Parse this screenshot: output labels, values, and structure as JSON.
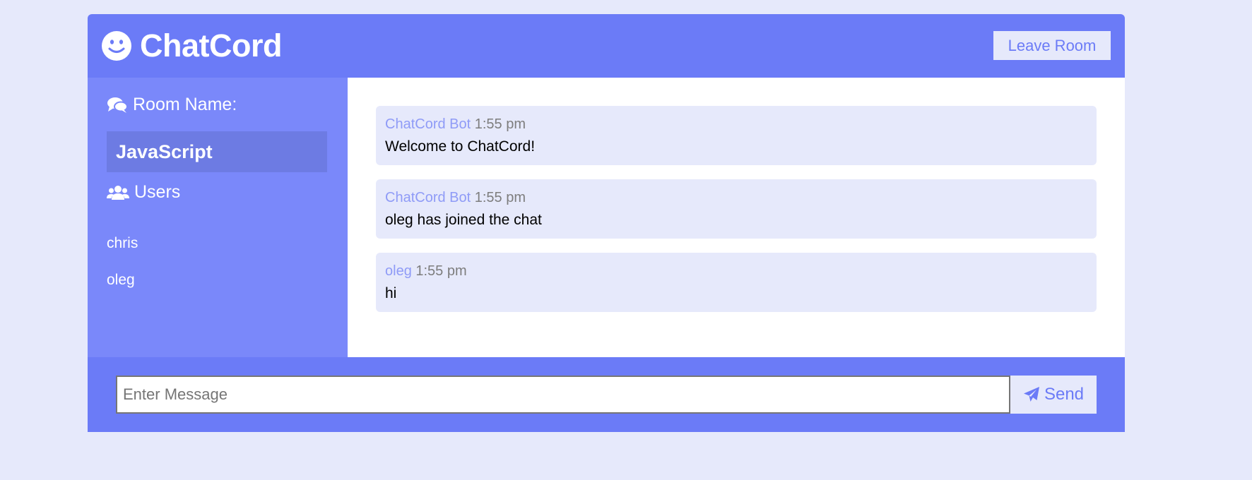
{
  "header": {
    "logo_icon": "smile-icon",
    "title": "ChatCord",
    "leave_label": "Leave Room"
  },
  "sidebar": {
    "room_heading_icon": "comments-icon",
    "room_heading": "Room Name:",
    "room_name": "JavaScript",
    "users_heading_icon": "users-icon",
    "users_heading": "Users",
    "users": [
      "chris",
      "oleg"
    ]
  },
  "messages": [
    {
      "user": "ChatCord Bot",
      "time": "1:55 pm",
      "text": "Welcome to ChatCord!"
    },
    {
      "user": "ChatCord Bot",
      "time": "1:55 pm",
      "text": "oleg has joined the chat"
    },
    {
      "user": "oleg",
      "time": "1:55 pm",
      "text": "hi"
    }
  ],
  "form": {
    "placeholder": "Enter Message",
    "value": "",
    "send_icon": "paper-plane-icon",
    "send_label": "Send"
  },
  "colors": {
    "page_background": "#e6e9fb",
    "primary": "#6b7bf7",
    "sidebar": "#7a88fa",
    "room_box": "#6d7be3",
    "message_background": "#e6e9fb",
    "username": "#8f9bf7",
    "timestamp": "#7d7d7d"
  }
}
